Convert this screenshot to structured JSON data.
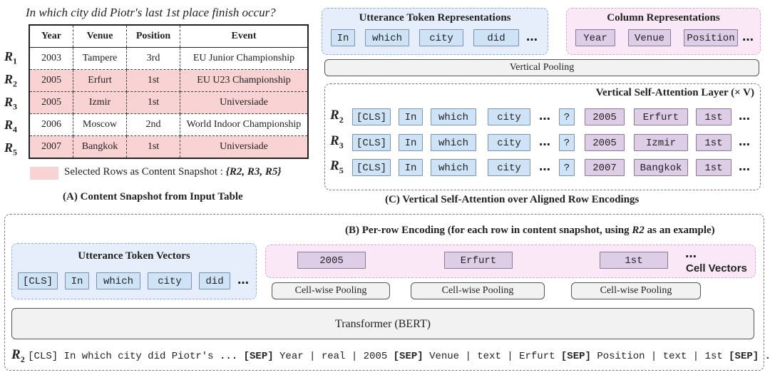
{
  "question": "In which city did Piotr's last 1st place finish occur?",
  "table": {
    "headers": [
      "Year",
      "Venue",
      "Position",
      "Event"
    ],
    "rows": [
      {
        "label": "R",
        "sub": "1",
        "cells": [
          "2003",
          "Tampere",
          "3rd",
          "EU Junior Championship"
        ],
        "selected": false
      },
      {
        "label": "R",
        "sub": "2",
        "cells": [
          "2005",
          "Erfurt",
          "1st",
          "EU U23 Championship"
        ],
        "selected": true
      },
      {
        "label": "R",
        "sub": "3",
        "cells": [
          "2005",
          "Izmir",
          "1st",
          "Universiade"
        ],
        "selected": true
      },
      {
        "label": "R",
        "sub": "4",
        "cells": [
          "2006",
          "Moscow",
          "2nd",
          "World Indoor Championship"
        ],
        "selected": false
      },
      {
        "label": "R",
        "sub": "5",
        "cells": [
          "2007",
          "Bangkok",
          "1st",
          "Universiade"
        ],
        "selected": true
      }
    ]
  },
  "legend": {
    "text": "Selected Rows as Content Snapshot :",
    "set": "{R2, R3, R5}",
    "swatch_color": "#f9d2d3"
  },
  "caption_a": "(A) Content Snapshot from Input Table",
  "utterance_repr": {
    "title": "Utterance Token Representations",
    "tokens": [
      "In",
      "which",
      "city",
      "did"
    ],
    "more": "…"
  },
  "column_repr": {
    "title": "Column Representations",
    "tokens": [
      "Year",
      "Venue",
      "Position"
    ],
    "more": "…"
  },
  "vertical_pooling": "Vertical Pooling",
  "vertical_attention": {
    "title": "Vertical Self-Attention Layer",
    "multiplier": "(× V)",
    "rows": [
      {
        "label": "R",
        "sub": "2",
        "tokens": [
          "[CLS]",
          "In",
          "which",
          "city"
        ],
        "q": "?",
        "cells": [
          "2005",
          "Erfurt",
          "1st"
        ]
      },
      {
        "label": "R",
        "sub": "3",
        "tokens": [
          "[CLS]",
          "In",
          "which",
          "city"
        ],
        "q": "?",
        "cells": [
          "2005",
          "Izmir",
          "1st"
        ]
      },
      {
        "label": "R",
        "sub": "5",
        "tokens": [
          "[CLS]",
          "In",
          "which",
          "city"
        ],
        "q": "?",
        "cells": [
          "2007",
          "Bangkok",
          "1st"
        ]
      }
    ],
    "more": "…"
  },
  "caption_c": "(C) Vertical Self-Attention over Aligned Row Encodings",
  "caption_b": {
    "text": "(B) Per-row Encoding (for each row in content snapshot, using",
    "var": "R2",
    "tail": "as an example)"
  },
  "utterance_vectors": {
    "title": "Utterance Token Vectors",
    "tokens": [
      "[CLS]",
      "In",
      "which",
      "city",
      "did"
    ],
    "more": "…"
  },
  "cell_vectors": {
    "label": "Cell Vectors",
    "cells": [
      "2005",
      "Erfurt",
      "1st"
    ],
    "more": "…",
    "pooling": [
      "Cell-wise Pooling",
      "Cell-wise Pooling",
      "Cell-wise Pooling"
    ]
  },
  "transformer": "Transformer (BERT)",
  "input_sequence": {
    "label": "R",
    "sub": "2",
    "parts": [
      {
        "text": "[CLS] In which city did Piotr's ",
        "sep": false
      },
      {
        "text": "...",
        "sep": true
      },
      {
        "text": " ",
        "sep": false
      },
      {
        "text": "[SEP]",
        "sep": true
      },
      {
        "text": " Year | real | 2005 ",
        "sep": false
      },
      {
        "text": "[SEP]",
        "sep": true
      },
      {
        "text": " Venue | text | Erfurt ",
        "sep": false
      },
      {
        "text": "[SEP]",
        "sep": true
      },
      {
        "text": " Position | text | 1st ",
        "sep": false
      },
      {
        "text": "[SEP]",
        "sep": true
      },
      {
        "text": " ...",
        "sep": true
      }
    ]
  },
  "colors": {
    "blue_token": "#cfe3f7",
    "purple_token": "#decde6",
    "blue_group": "#e5eefa",
    "pink_group": "#fbe8f6",
    "selected_row": "#f9d2d3"
  }
}
